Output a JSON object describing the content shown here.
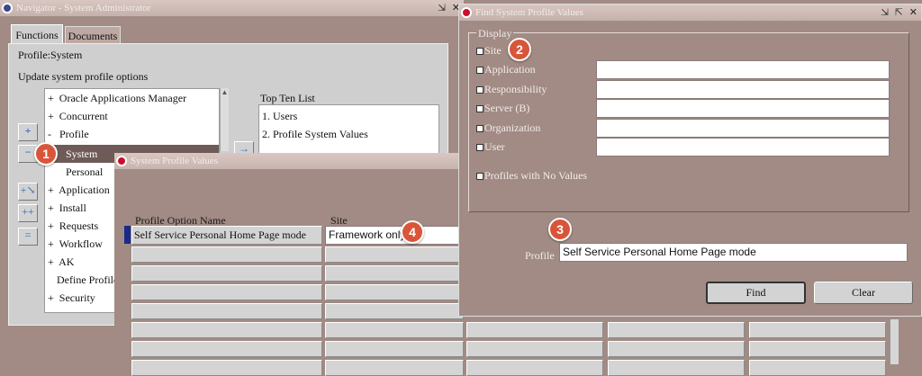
{
  "navigator": {
    "title": "Navigator - System Administrator",
    "tabs": [
      "Functions",
      "Documents"
    ],
    "profile_label": "Profile:System",
    "instruction": "Update system profile options",
    "tree": [
      {
        "prefix": "+",
        "label": "Oracle Applications Manager"
      },
      {
        "prefix": "+",
        "label": "Concurrent"
      },
      {
        "prefix": "-",
        "label": "Profile"
      },
      {
        "prefix": "",
        "label": "System"
      },
      {
        "prefix": "",
        "label": "Personal"
      },
      {
        "prefix": "+",
        "label": "Application"
      },
      {
        "prefix": "+",
        "label": "Install"
      },
      {
        "prefix": "+",
        "label": "Requests"
      },
      {
        "prefix": "+",
        "label": "Workflow"
      },
      {
        "prefix": "+",
        "label": "AK"
      },
      {
        "prefix": "",
        "label": "Define Profile"
      },
      {
        "prefix": "+",
        "label": "Security"
      }
    ],
    "top_ten_title": "Top Ten List",
    "top_ten": [
      "1. Users",
      "2. Profile System Values"
    ]
  },
  "profile_values": {
    "title": "System Profile Values",
    "col_option": "Profile Option Name",
    "col_site": "Site",
    "row1_option": "Self Service Personal Home Page mode",
    "row1_site": "Framework only"
  },
  "find_dialog": {
    "title": "Find System Profile Values",
    "group_label": "Display",
    "checks": [
      {
        "label": "Site",
        "checked": "✓"
      },
      {
        "label": "Application",
        "checked": ""
      },
      {
        "label": "Responsibility",
        "checked": ""
      },
      {
        "label": "Server (B)",
        "checked": ""
      },
      {
        "label": "Organization",
        "checked": ""
      },
      {
        "label": "User",
        "checked": ""
      }
    ],
    "no_values_label": "Profiles with No Values",
    "no_values_checked": "✓",
    "profile_label": "Profile",
    "profile_value": "Self Service Personal Home Page mode",
    "find_label": "Find",
    "clear_label": "Clear"
  },
  "markers": [
    "1",
    "2",
    "3",
    "4"
  ],
  "colors": {
    "background": "#a18b84",
    "marker": "#d9553a",
    "oracle_red": "#c8102e"
  }
}
